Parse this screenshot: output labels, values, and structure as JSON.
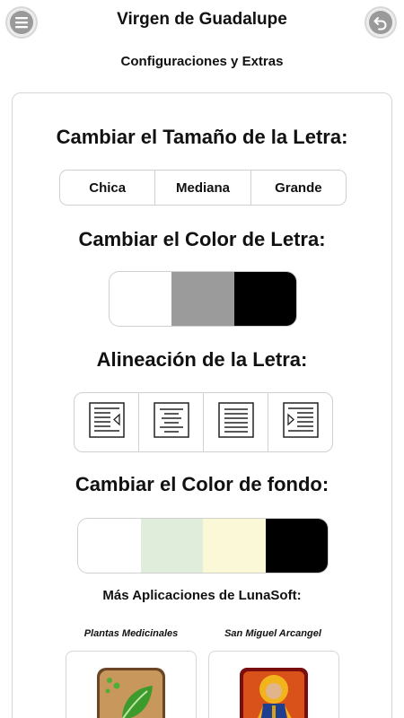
{
  "header": {
    "title": "Virgen de Guadalupe",
    "subtitle": "Configuraciones y Extras",
    "menu_icon": "menu-icon",
    "back_icon": "back-arrow-icon"
  },
  "font_size": {
    "title": "Cambiar el Tamaño de la Letra:",
    "options": [
      "Chica",
      "Mediana",
      "Grande"
    ]
  },
  "font_color": {
    "title": "Cambiar el Color de Letra:",
    "swatches": [
      "#ffffff",
      "#9b9b9b",
      "#000000"
    ]
  },
  "alignment": {
    "title": "Alineación de la Letra:",
    "options": [
      "align-indent-left-icon",
      "align-center-icon",
      "align-justify-icon",
      "align-indent-right-icon"
    ]
  },
  "background_color": {
    "title": "Cambiar el Color de fondo:",
    "swatches": [
      "#ffffff",
      "#e1eddb",
      "#fbf8d8",
      "#000000"
    ]
  },
  "more_apps": {
    "title": "Más Aplicaciones de LunaSoft:",
    "apps": [
      {
        "label": "Plantas Medicinales",
        "icon": "leaf-app-icon"
      },
      {
        "label": "San Miguel Arcangel",
        "icon": "archangel-app-icon"
      }
    ]
  }
}
